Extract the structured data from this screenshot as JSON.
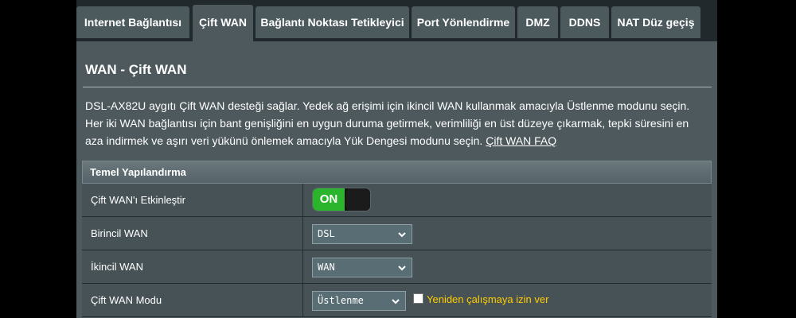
{
  "tabs": [
    {
      "label": "Internet Bağlantısı",
      "active": false
    },
    {
      "label": "Çift WAN",
      "active": true
    },
    {
      "label": "Bağlantı Noktası Tetikleyici",
      "active": false
    },
    {
      "label": "Port Yönlendirme",
      "active": false
    },
    {
      "label": "DMZ",
      "active": false
    },
    {
      "label": "DDNS",
      "active": false
    },
    {
      "label": "NAT Düz geçiş",
      "active": false
    }
  ],
  "page": {
    "title": "WAN - Çift WAN",
    "description": "DSL-AX82U aygıtı Çift WAN desteği sağlar. Yedek ağ erişimi için ikincil WAN kullanmak amacıyla Üstlenme modunu seçin. Her iki WAN bağlantısı için bant genişliğini en uygun duruma getirmek, verimliliği en üst düzeye çıkarmak, tepki süresini en aza indirmek ve aşırı veri yükünü önlemek amacıyla Yük Dengesi modunu seçin.",
    "faq_link": "Çift WAN FAQ"
  },
  "config": {
    "header": "Temel Yapılandırma",
    "enable_label": "Çift WAN'ı Etkinleştir",
    "enable_state": "ON",
    "primary_label": "Birincil WAN",
    "primary_value": "DSL",
    "secondary_label": "İkincil WAN",
    "secondary_value": "WAN",
    "mode_label": "Çift WAN Modu",
    "mode_value": "Üstlenme",
    "allow_failback_label": "Yeniden çalışmaya izin ver",
    "allow_failback_checked": false
  },
  "colors": {
    "toggle_on": "#2bb52d",
    "warning_text": "#ffcc00",
    "panel_bg": "#4d595d"
  }
}
